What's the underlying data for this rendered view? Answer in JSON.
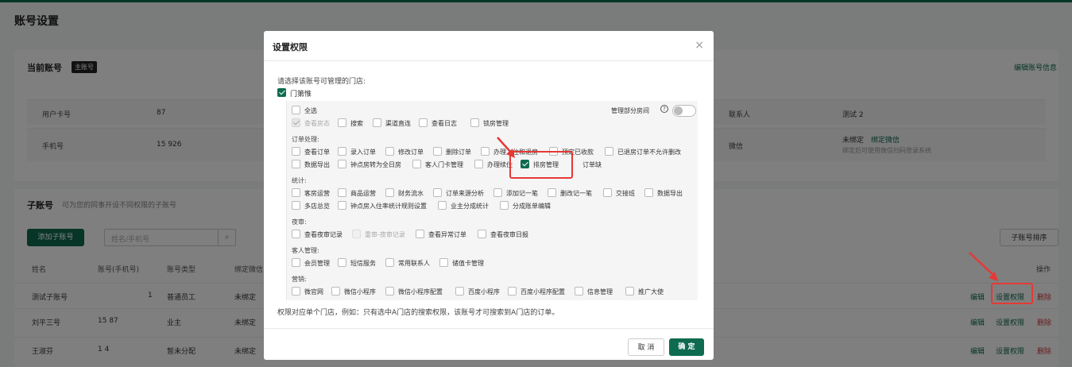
{
  "page": {
    "title": "账号设置",
    "current_account": {
      "title": "当前账号",
      "badge": "主账号",
      "edit_link": "编辑账号信息",
      "user_card_label": "用户卡号",
      "user_card_value": "87",
      "phone_label": "手机号",
      "phone_value": "15      926",
      "contact_label": "联系人",
      "contact_value": "测试    2",
      "wechat_label": "微信",
      "wechat_status": "未绑定",
      "wechat_bind_link": "绑定微信",
      "wechat_hint": "绑定后可使用微信扫码登录系统"
    },
    "sub_accounts": {
      "title": "子账号",
      "desc": "可为您的同事开设不同权限的子账号",
      "add_button": "添加子账号",
      "search_placeholder": "姓名/手机号",
      "sort_button": "子账号排序",
      "columns": [
        "姓名",
        "账号(手机号)",
        "账号类型",
        "绑定微信",
        "操作"
      ],
      "rows": [
        {
          "name": "测试子账号",
          "phone": "1",
          "type": "普通员工",
          "wechat": "未绑定"
        },
        {
          "name": "刘平三号",
          "phone": "15         87",
          "type": "业主",
          "wechat": "未绑定"
        },
        {
          "name": "王淑芬",
          "phone": "1           4",
          "type": "暂未分配",
          "wechat": "未绑定"
        }
      ],
      "actions": {
        "edit": "编辑",
        "perm": "设置权限",
        "del": "删除"
      }
    }
  },
  "modal": {
    "title": "设置权限",
    "close": "×",
    "prompt": "请选择该账号可管理的门店:",
    "store": "门第惟",
    "select_all": "全选",
    "manage_rooms": "管理部分房间",
    "hint": "?",
    "row_basic": [
      "查看房态",
      "搜索",
      "渠道直连",
      "查看日志",
      "锁房管理"
    ],
    "order_title": "订单处理:",
    "order_row1": [
      "查看订单",
      "录入订单",
      "修改订单",
      "删除订单",
      "办理入住和退房",
      "预定已收款",
      "已退房订单不允许删改"
    ],
    "order_row2": [
      "数据导出",
      "钟点房转为全日房",
      "客人门卡管理",
      "办理续住",
      "排房管理",
      "订单缺"
    ],
    "stats_title": "统计:",
    "stats_row1": [
      "客房运营",
      "商品运营",
      "财务流水",
      "订单来源分析",
      "添加记一笔",
      "删改记一笔",
      "交接班",
      "数据导出"
    ],
    "stats_row2": [
      "多店总览",
      "钟点房入住率统计规则设置",
      "业主分成统计",
      "分成账单编辑"
    ],
    "night_title": "夜审:",
    "night_row": [
      "查看夜审记录",
      "重审-夜审记录",
      "查看异常订单",
      "查看夜审日报"
    ],
    "guest_title": "客人管理:",
    "guest_row": [
      "会员管理",
      "短信服务",
      "常用联系人",
      "储值卡管理"
    ],
    "marketing_title": "营销:",
    "marketing_row": [
      "微官网",
      "微信小程序",
      "微信小程序配置",
      "百度小程序",
      "百度小程序配置",
      "信息管理",
      "推广大使"
    ],
    "note": "权限对应单个门店，例如：只有选中A门店的搜索权限，该账号才可搜索到A门店的订单。",
    "cancel": "取 消",
    "confirm": "确 定"
  },
  "colors": {
    "brand": "#0e6b4f",
    "danger": "#d9363e",
    "highlight": "#e53935"
  }
}
